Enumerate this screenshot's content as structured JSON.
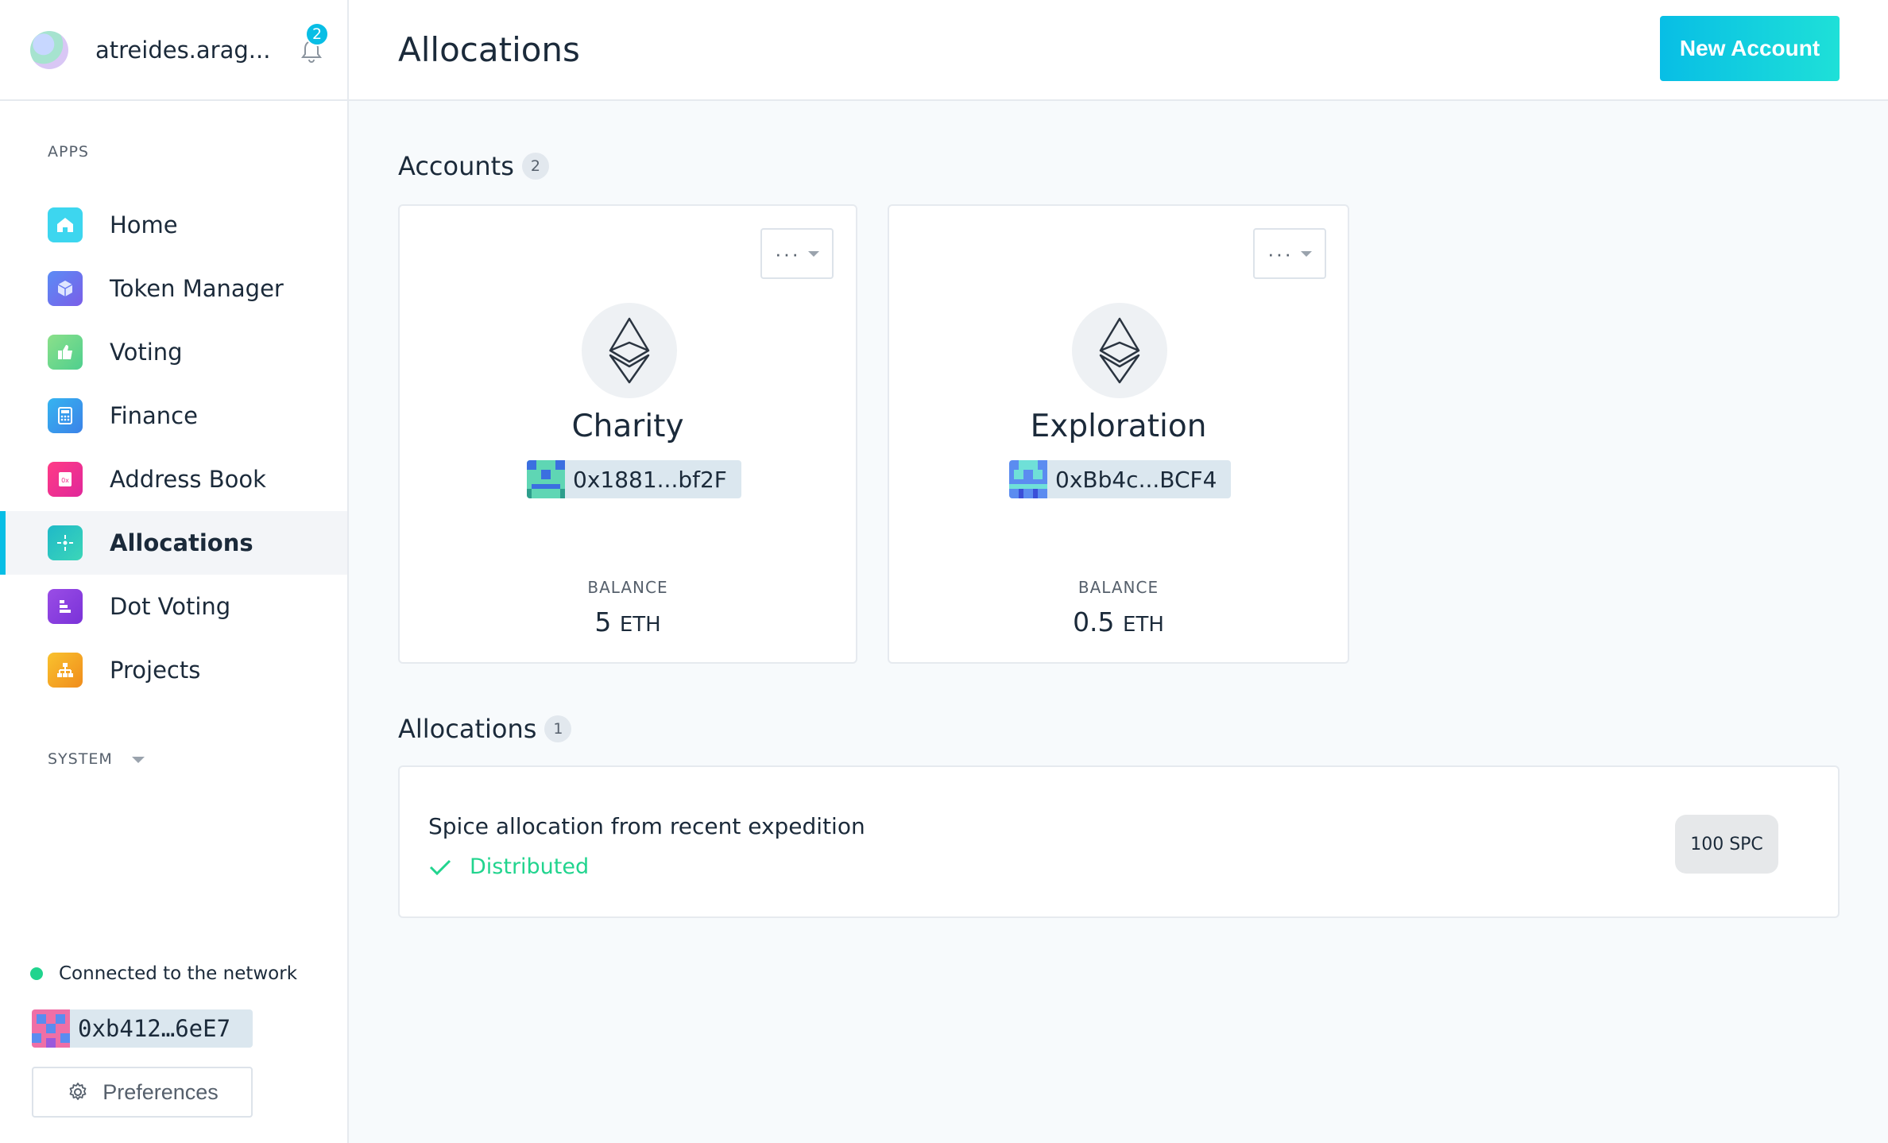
{
  "org": {
    "name": "atreides.arag...",
    "notifications_count": "2"
  },
  "sidebar": {
    "apps_label": "APPS",
    "items": [
      {
        "label": "Home",
        "icon": "home-icon",
        "color": "#3dd6ef"
      },
      {
        "label": "Token Manager",
        "icon": "cube-icon",
        "color": "#6a7cf3"
      },
      {
        "label": "Voting",
        "icon": "thumbs-icon",
        "color": "#6fd97d"
      },
      {
        "label": "Finance",
        "icon": "calculator-icon",
        "color": "#3a9cee"
      },
      {
        "label": "Address Book",
        "icon": "address-book-icon",
        "color": "#f02c8a"
      },
      {
        "label": "Allocations",
        "icon": "allocations-icon",
        "color": "#2fc7c0"
      },
      {
        "label": "Dot Voting",
        "icon": "dot-voting-icon",
        "color": "#8a3ee0"
      },
      {
        "label": "Projects",
        "icon": "projects-icon",
        "color": "#f4a81e"
      }
    ],
    "active_item": "Allocations",
    "system_label": "SYSTEM",
    "network_status": "Connected to the network",
    "account": "0xb412…6eE7",
    "preferences_label": "Preferences"
  },
  "header": {
    "title": "Allocations",
    "new_account_label": "New Account"
  },
  "accounts": {
    "heading": "Accounts",
    "count": "2",
    "items": [
      {
        "name": "Charity",
        "address": "0x1881...bf2F",
        "balance_label": "BALANCE",
        "balance_value": "5",
        "balance_unit": "ETH",
        "menu_label": "···"
      },
      {
        "name": "Exploration",
        "address": "0xBb4c...BCF4",
        "balance_label": "BALANCE",
        "balance_value": "0.5",
        "balance_unit": "ETH",
        "menu_label": "···"
      }
    ]
  },
  "allocations": {
    "heading": "Allocations",
    "count": "1",
    "items": [
      {
        "description": "Spice allocation from recent expedition",
        "status": "Distributed",
        "amount": "100 SPC"
      }
    ]
  },
  "colors": {
    "accent": "#08bee5",
    "success": "#21d48e"
  }
}
